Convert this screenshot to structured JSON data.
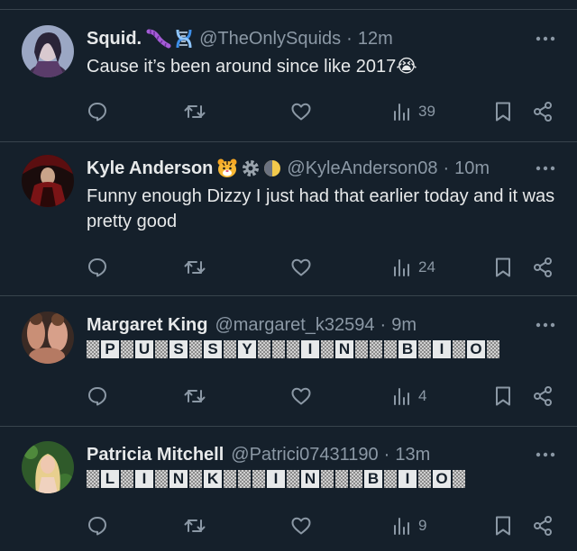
{
  "colors": {
    "background": "#15202b",
    "divider": "#38444d",
    "muted": "#8b98a5",
    "text": "#e7e9ea"
  },
  "tweets": [
    {
      "name": "Squid.",
      "badges": [
        "worm-emoji",
        "dna-emoji"
      ],
      "handle": "@TheOnlySquids",
      "dot": "·",
      "time": "12m",
      "text": "Cause it’s been around since like 2017",
      "text_emoji": "😭",
      "views": "39"
    },
    {
      "name": "Kyle Anderson",
      "badges": [
        "tiger-emoji",
        "gear-emoji",
        "moon-emoji"
      ],
      "handle": "@KyleAnderson08",
      "dot": "·",
      "time": "10m",
      "text": "Funny enough Dizzy I just had that earlier today and it was pretty good",
      "views": "24"
    },
    {
      "name": "Margaret King",
      "handle": "@margaret_k32594",
      "dot": "·",
      "time": "9m",
      "spam_text": "PUSSY IN BIO",
      "views": "4"
    },
    {
      "name": "Patricia Mitchell",
      "handle": "@Patrici07431190",
      "dot": "·",
      "time": "13m",
      "spam_text": "LINK IN BIO",
      "views": "9"
    }
  ],
  "icons": [
    "reply-icon",
    "retweet-icon",
    "like-icon",
    "views-icon",
    "bookmark-icon",
    "share-icon",
    "more-icon"
  ]
}
